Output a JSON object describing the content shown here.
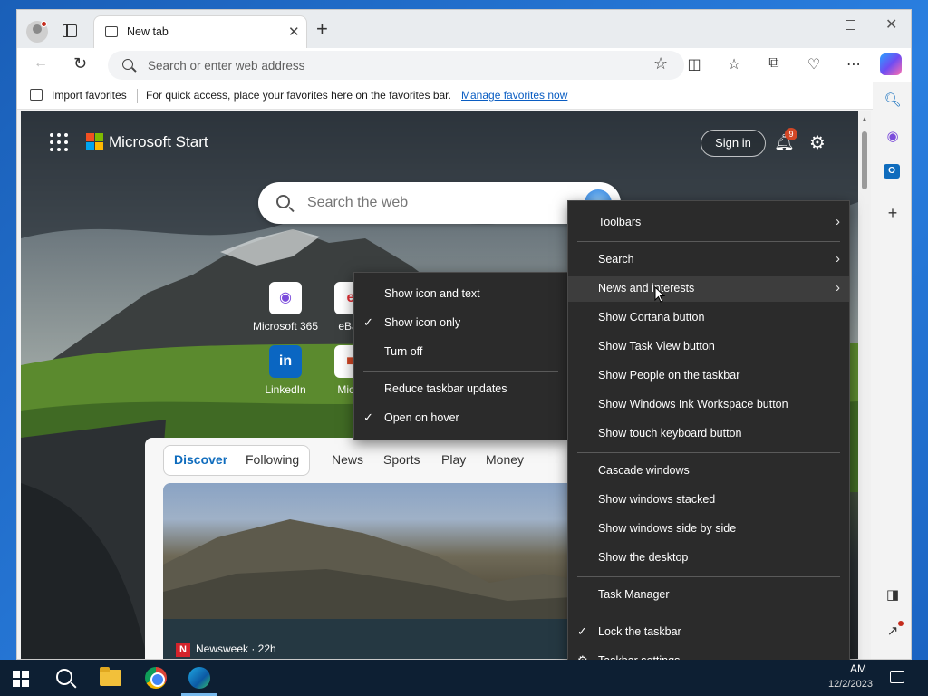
{
  "browser": {
    "tab_title": "New tab",
    "tab_close": "✕",
    "new_tab": "+",
    "address_placeholder": "Search or enter web address",
    "favorites_bar": {
      "import_label": "Import favorites",
      "hint": "For quick access, place your favorites here on the favorites bar.",
      "manage_link": "Manage favorites now"
    }
  },
  "start_page": {
    "brand": "Microsoft Start",
    "sign_in": "Sign in",
    "notification_count": "9",
    "search_placeholder": "Search the web",
    "quick_links": [
      {
        "label": "Microsoft 365"
      },
      {
        "label": "eBay"
      },
      {
        "label": "LinkedIn"
      },
      {
        "label": "Micro"
      }
    ],
    "feed_tabs": [
      "Discover",
      "Following",
      "News",
      "Sports",
      "Play",
      "Money"
    ],
    "news_source": "Newsweek · 22h"
  },
  "submenu": {
    "items": [
      {
        "label": "Show icon and text",
        "checked": false
      },
      {
        "label": "Show icon only",
        "checked": true
      },
      {
        "label": "Turn off",
        "checked": false
      },
      {
        "label": "Reduce taskbar updates",
        "checked": false
      },
      {
        "label": "Open on hover",
        "checked": true
      }
    ]
  },
  "context_menu": {
    "items": [
      {
        "label": "Toolbars",
        "submenu": true
      },
      {
        "label": "Search",
        "submenu": true
      },
      {
        "label": "News and interests",
        "submenu": true,
        "highlighted": true
      },
      {
        "label": "Show Cortana button"
      },
      {
        "label": "Show Task View button"
      },
      {
        "label": "Show People on the taskbar"
      },
      {
        "label": "Show Windows Ink Workspace button"
      },
      {
        "label": "Show touch keyboard button"
      },
      {
        "label": "Cascade windows"
      },
      {
        "label": "Show windows stacked"
      },
      {
        "label": "Show windows side by side"
      },
      {
        "label": "Show the desktop"
      },
      {
        "label": "Task Manager"
      },
      {
        "label": "Lock the taskbar",
        "checked": true
      },
      {
        "label": "Taskbar settings"
      }
    ]
  },
  "taskbar": {
    "time": "AM",
    "date": "12/2/2023"
  },
  "colors": {
    "menu_bg": "#2b2b2b",
    "menu_hover": "#3d3d3d",
    "accent": "#0f6cbd",
    "taskbar_bg": "#0d1f33"
  }
}
